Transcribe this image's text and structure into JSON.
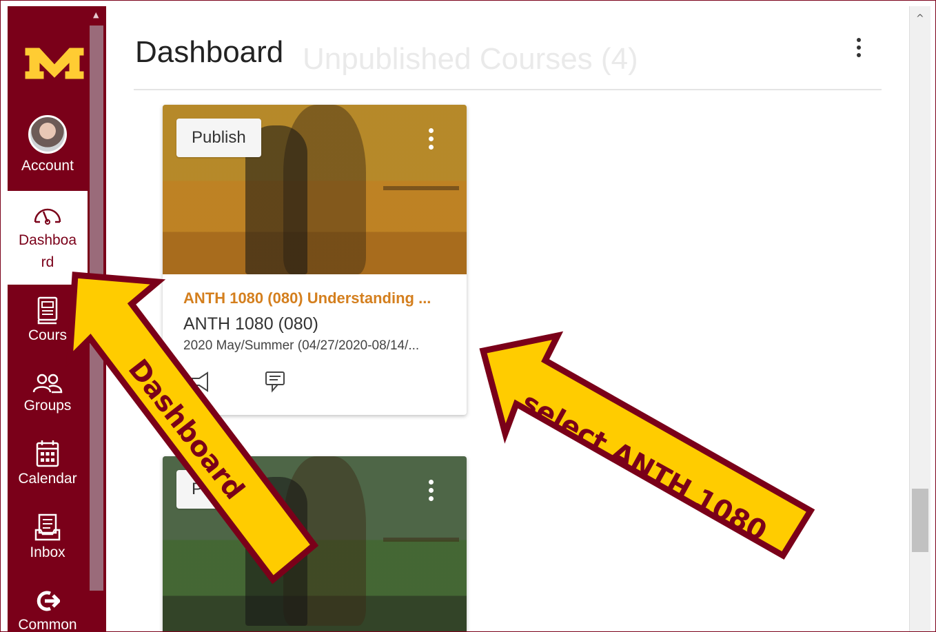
{
  "nav": {
    "logo_alt": "M",
    "account_label": "Account",
    "dashboard_label_1": "Dashboa",
    "dashboard_label_2": "rd",
    "courses_label": "Cours",
    "groups_label": "Groups",
    "calendar_label": "Calendar",
    "inbox_label": "Inbox",
    "commons_label": "Common"
  },
  "header": {
    "title": "Dashboard",
    "ghost_title": "Unpublished Courses (4)"
  },
  "cards": [
    {
      "publish_label": "Publish",
      "link_text": "ANTH 1080 (080) Understanding ...",
      "code": "ANTH 1080 (080)",
      "term": "2020 May/Summer (04/27/2020-08/14/..."
    },
    {
      "publish_label": "Pu"
    }
  ],
  "annotations": {
    "dashboard_arrow_text": "Dashboard",
    "select_arrow_text": "select ANTH 1080"
  },
  "colors": {
    "umn_maroon": "#7a0019",
    "umn_gold": "#ffcc33",
    "link_orange": "#d47f1e"
  },
  "icons": [
    "dashboard-gauge-icon",
    "courses-book-icon",
    "groups-icon",
    "calendar-icon",
    "inbox-icon",
    "commons-arrow-icon",
    "announcements-icon",
    "discussions-icon"
  ]
}
